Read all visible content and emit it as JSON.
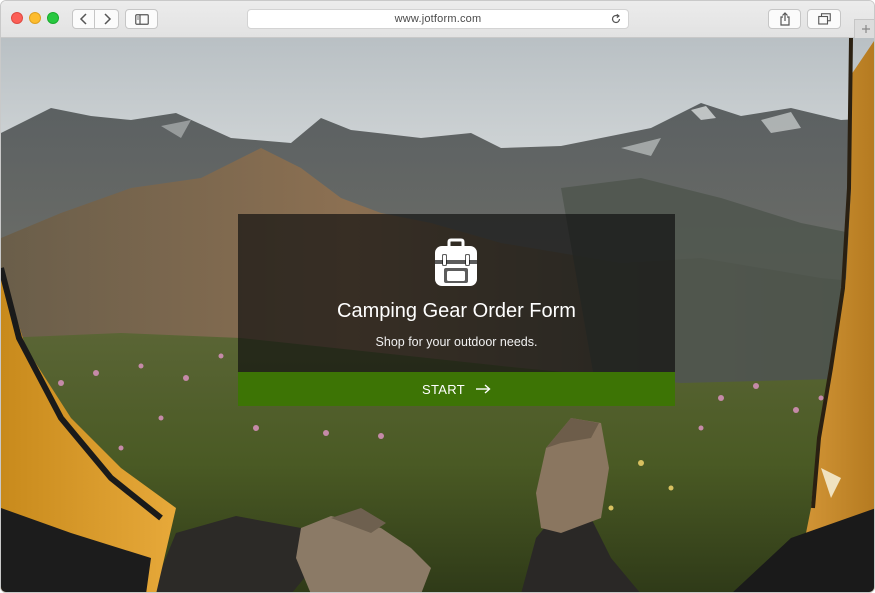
{
  "browser": {
    "url": "www.jotform.com",
    "buttons": {
      "back": "back-icon",
      "forward": "forward-icon",
      "sidebar": "sidebar-icon",
      "reload": "reload-icon",
      "share": "share-icon",
      "tabs": "tabs-icon",
      "new_tab": "plus-icon"
    }
  },
  "form": {
    "icon": "backpack-icon",
    "title": "Camping Gear Order Form",
    "subtitle": "Shop for your outdoor needs.",
    "start_label": "START",
    "start_icon": "arrow-right-icon"
  },
  "colors": {
    "start_button": "#3d7405",
    "card_overlay": "#0f0f0f",
    "traffic_red": "#fc5f57",
    "traffic_yellow": "#fdbc2e",
    "traffic_green": "#28c840"
  }
}
